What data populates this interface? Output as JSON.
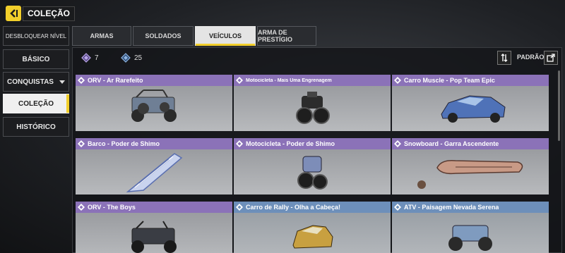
{
  "header": {
    "title": "COLEÇÃO"
  },
  "sidebar": {
    "items": [
      {
        "label": "DESBLOQUEAR NÍVEL"
      },
      {
        "label": "BÁSICO"
      },
      {
        "label": "CONQUISTAS"
      },
      {
        "label": "COLEÇÃO",
        "active": true
      },
      {
        "label": "HISTÓRICO"
      }
    ]
  },
  "tabs": [
    {
      "label": "ARMAS"
    },
    {
      "label": "SOLDADOS"
    },
    {
      "label": "VEÍCULOS",
      "active": true
    },
    {
      "label": "ARMA DE PRESTÍGIO"
    }
  ],
  "toolbar": {
    "counter_purple": "7",
    "counter_blue": "25",
    "sort_label": "PADRÃO"
  },
  "cards": [
    {
      "title": "ORV - Ar Rarefeito",
      "rarity": "purple",
      "vehicle": "orv"
    },
    {
      "title": "Motocicleta - Mais Uma Engrenagem",
      "rarity": "purple",
      "vehicle": "motorcycle"
    },
    {
      "title": "Carro Muscle - Pop Team Epic",
      "rarity": "purple",
      "vehicle": "muscle-car"
    },
    {
      "title": "Barco - Poder de Shimo",
      "rarity": "purple",
      "vehicle": "boat"
    },
    {
      "title": "Motocicleta - Poder de Shimo",
      "rarity": "purple",
      "vehicle": "motorcycle"
    },
    {
      "title": "Snowboard - Garra Ascendente",
      "rarity": "purple",
      "vehicle": "snowboard"
    },
    {
      "title": "ORV - The Boys",
      "rarity": "purple",
      "vehicle": "orv"
    },
    {
      "title": "Carro de Rally - Olha a Cabeça!",
      "rarity": "blue",
      "vehicle": "rally-car"
    },
    {
      "title": "ATV - Paisagem Nevada Serena",
      "rarity": "blue",
      "vehicle": "atv"
    }
  ],
  "colors": {
    "accent": "#f2cf2b",
    "epic": "#8b72b8",
    "rare": "#6d8fba"
  },
  "icons": [
    "back-arrow-icon",
    "purple-diamond-icon",
    "blue-diamond-icon",
    "sort-icon",
    "export-icon",
    "rarity-icon"
  ]
}
